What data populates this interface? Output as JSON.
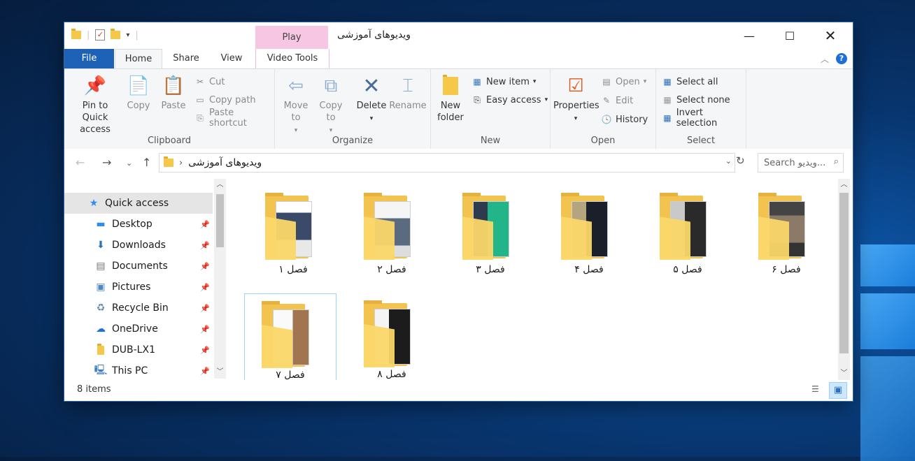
{
  "window": {
    "title": "ویدیوهای آموزشی",
    "context_tab": "Play"
  },
  "tabs": [
    "File",
    "Home",
    "Share",
    "View",
    "Video Tools"
  ],
  "ribbon": {
    "clipboard": {
      "label": "Clipboard",
      "pin": "Pin to Quick access",
      "copy": "Copy",
      "paste": "Paste",
      "cut": "Cut",
      "copy_path": "Copy path",
      "paste_shortcut": "Paste shortcut"
    },
    "organize": {
      "label": "Organize",
      "move_to": "Move to",
      "copy_to": "Copy to",
      "delete": "Delete",
      "rename": "Rename"
    },
    "new": {
      "label": "New",
      "new_folder": "New folder",
      "new_item": "New item",
      "easy_access": "Easy access"
    },
    "open": {
      "label": "Open",
      "properties": "Properties",
      "open": "Open",
      "edit": "Edit",
      "history": "History"
    },
    "select": {
      "label": "Select",
      "select_all": "Select all",
      "select_none": "Select none",
      "invert": "Invert selection"
    }
  },
  "address": {
    "path": "ویدیوهای آموزشی",
    "search_placeholder": "Search ویدیو..."
  },
  "nav": [
    {
      "label": "Quick access",
      "icon": "star-icon"
    },
    {
      "label": "Desktop",
      "icon": "desktop-icon"
    },
    {
      "label": "Downloads",
      "icon": "download-icon"
    },
    {
      "label": "Documents",
      "icon": "documents-icon"
    },
    {
      "label": "Pictures",
      "icon": "pictures-icon"
    },
    {
      "label": "Recycle Bin",
      "icon": "recycle-bin-icon"
    },
    {
      "label": "OneDrive",
      "icon": "cloud-icon"
    },
    {
      "label": "DUB-LX1",
      "icon": "folder-icon"
    },
    {
      "label": "This PC",
      "icon": "computer-icon"
    }
  ],
  "folders": [
    {
      "label": "فصل ۱"
    },
    {
      "label": "فصل ۲"
    },
    {
      "label": "فصل ۳"
    },
    {
      "label": "فصل ۴"
    },
    {
      "label": "فصل ۵"
    },
    {
      "label": "فصل ۶"
    },
    {
      "label": "فصل ۷"
    },
    {
      "label": "فصل ۸"
    }
  ],
  "status": {
    "items": "8 items"
  },
  "colors": {
    "file_tab": "#1e62b8",
    "context_tab": "#f6c6e2",
    "folder": "#f2c34f",
    "selection": "#99d1ff"
  }
}
